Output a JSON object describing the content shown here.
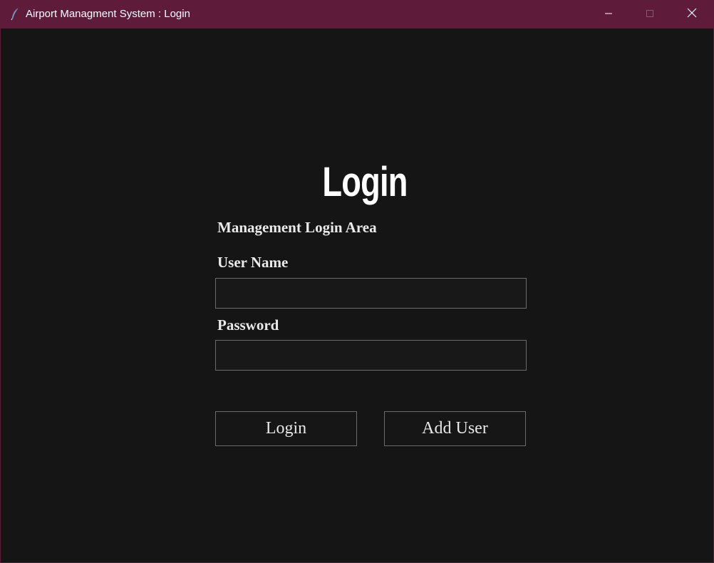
{
  "window": {
    "title": "Airport Managment System : Login",
    "icon": "feather-icon",
    "controls": [
      "minimize-icon",
      "maximize-icon",
      "close-icon"
    ]
  },
  "login": {
    "heading": "Login",
    "subtitle": "Management Login Area",
    "username_label": "User Name",
    "username_value": "",
    "password_label": "Password",
    "password_value": "",
    "login_button": "Login",
    "add_user_button": "Add User"
  },
  "colors": {
    "titlebar": "#5e1b3a",
    "background": "#151515",
    "text": "#ffffff",
    "border": "#6b6b6b"
  }
}
